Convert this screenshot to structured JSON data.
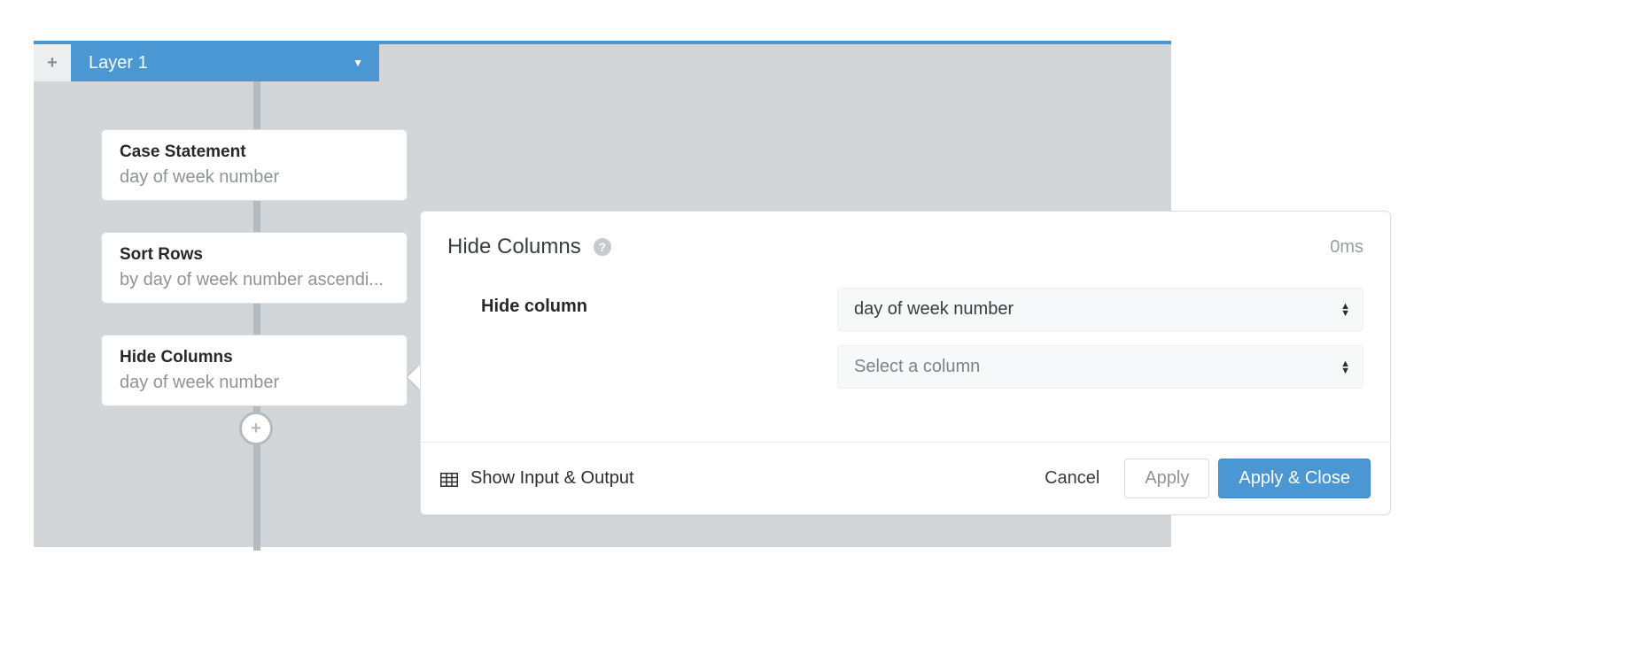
{
  "tab": {
    "layer_label": "Layer 1"
  },
  "nodes": [
    {
      "title": "Case Statement",
      "sub": "day of week number"
    },
    {
      "title": "Sort Rows",
      "sub": "by day of week number ascendi..."
    },
    {
      "title": "Hide Columns",
      "sub": "day of week number"
    }
  ],
  "panel": {
    "title": "Hide Columns",
    "timing": "0ms",
    "field_label": "Hide column",
    "selects": [
      {
        "value": "day of week number",
        "placeholder": false
      },
      {
        "value": "Select a column",
        "placeholder": true
      }
    ],
    "footer": {
      "show_io": "Show Input & Output",
      "cancel": "Cancel",
      "apply": "Apply",
      "apply_close": "Apply & Close"
    }
  }
}
